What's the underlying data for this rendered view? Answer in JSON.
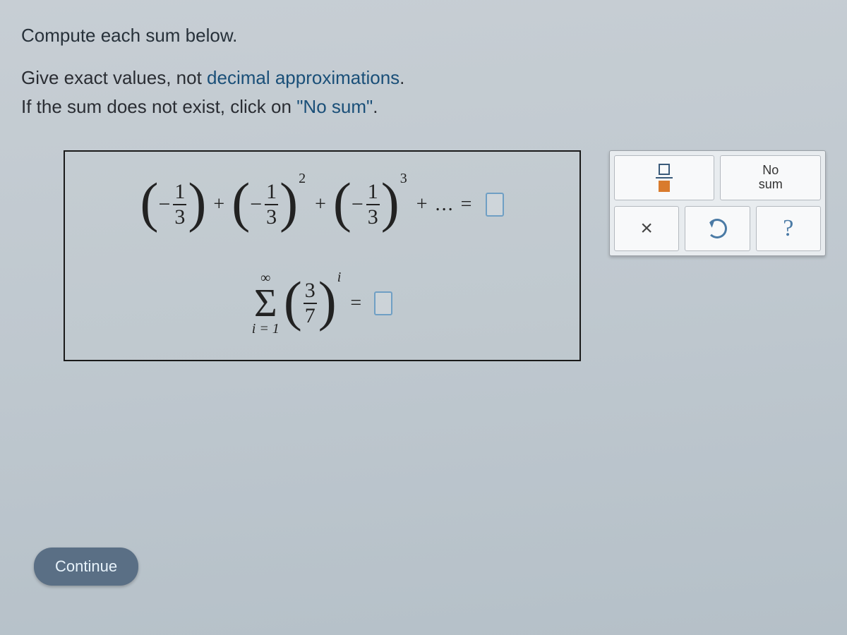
{
  "instructions": {
    "line1": "Compute each sum below.",
    "line2_a": "Give exact values, not ",
    "line2_b": "decimal approximations",
    "line2_c": ".",
    "line3_a": "If the sum does not exist, click on ",
    "line3_b": "\"No sum\"",
    "line3_c": "."
  },
  "equations": {
    "eq1": {
      "terms": [
        {
          "sign": "−",
          "num": "1",
          "den": "3",
          "exp": ""
        },
        {
          "sign": "−",
          "num": "1",
          "den": "3",
          "exp": "2"
        },
        {
          "sign": "−",
          "num": "1",
          "den": "3",
          "exp": "3"
        }
      ],
      "op_plus": "+",
      "tail": "+ ... =",
      "answer": ""
    },
    "eq2": {
      "sigma_top": "∞",
      "sigma_bottom_var": "i",
      "sigma_bottom_eq": " = 1",
      "frac_num": "3",
      "frac_den": "7",
      "exp_var": "i",
      "equals": "=",
      "answer": ""
    }
  },
  "tools": {
    "fraction_label": "fraction-template",
    "nosum_line1": "No",
    "nosum_line2": "sum",
    "clear_label": "×",
    "reset_label": "reset",
    "help_label": "?"
  },
  "continue_label": "Continue"
}
